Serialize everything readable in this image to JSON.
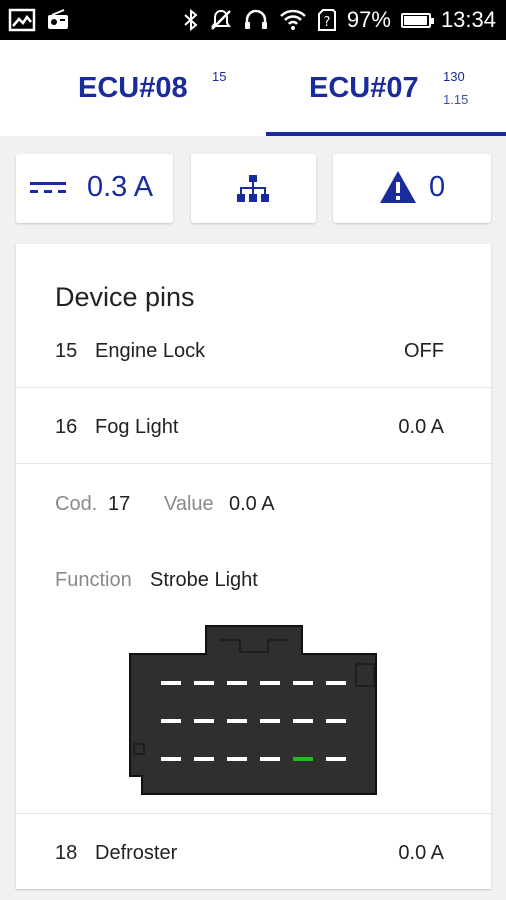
{
  "status_bar": {
    "battery": "97%",
    "battery_level": 0.97,
    "time": "13:34"
  },
  "tabs": [
    {
      "name": "ECU#08",
      "sup": "15",
      "selected": false
    },
    {
      "name": "ECU#07",
      "sup": "130",
      "sub": "1.15",
      "selected": true
    }
  ],
  "summary": {
    "current": "0.3 A",
    "alerts": "0"
  },
  "device_pins": {
    "title": "Device pins",
    "rows": [
      {
        "num": "15",
        "name": "Engine Lock",
        "value": "OFF"
      },
      {
        "num": "16",
        "name": "Fog Light",
        "value": "0.0 A"
      }
    ],
    "detail": {
      "cod_label": "Cod.",
      "cod_value": "17",
      "value_label": "Value",
      "value_value": "0.0 A",
      "function_label": "Function",
      "function_value": "Strobe Light",
      "active_pin": 17
    },
    "last_row": {
      "num": "18",
      "name": "Defroster",
      "value": "0.0 A"
    }
  },
  "colors": {
    "accent": "#1a2b9e",
    "active_pin": "#17c317"
  }
}
